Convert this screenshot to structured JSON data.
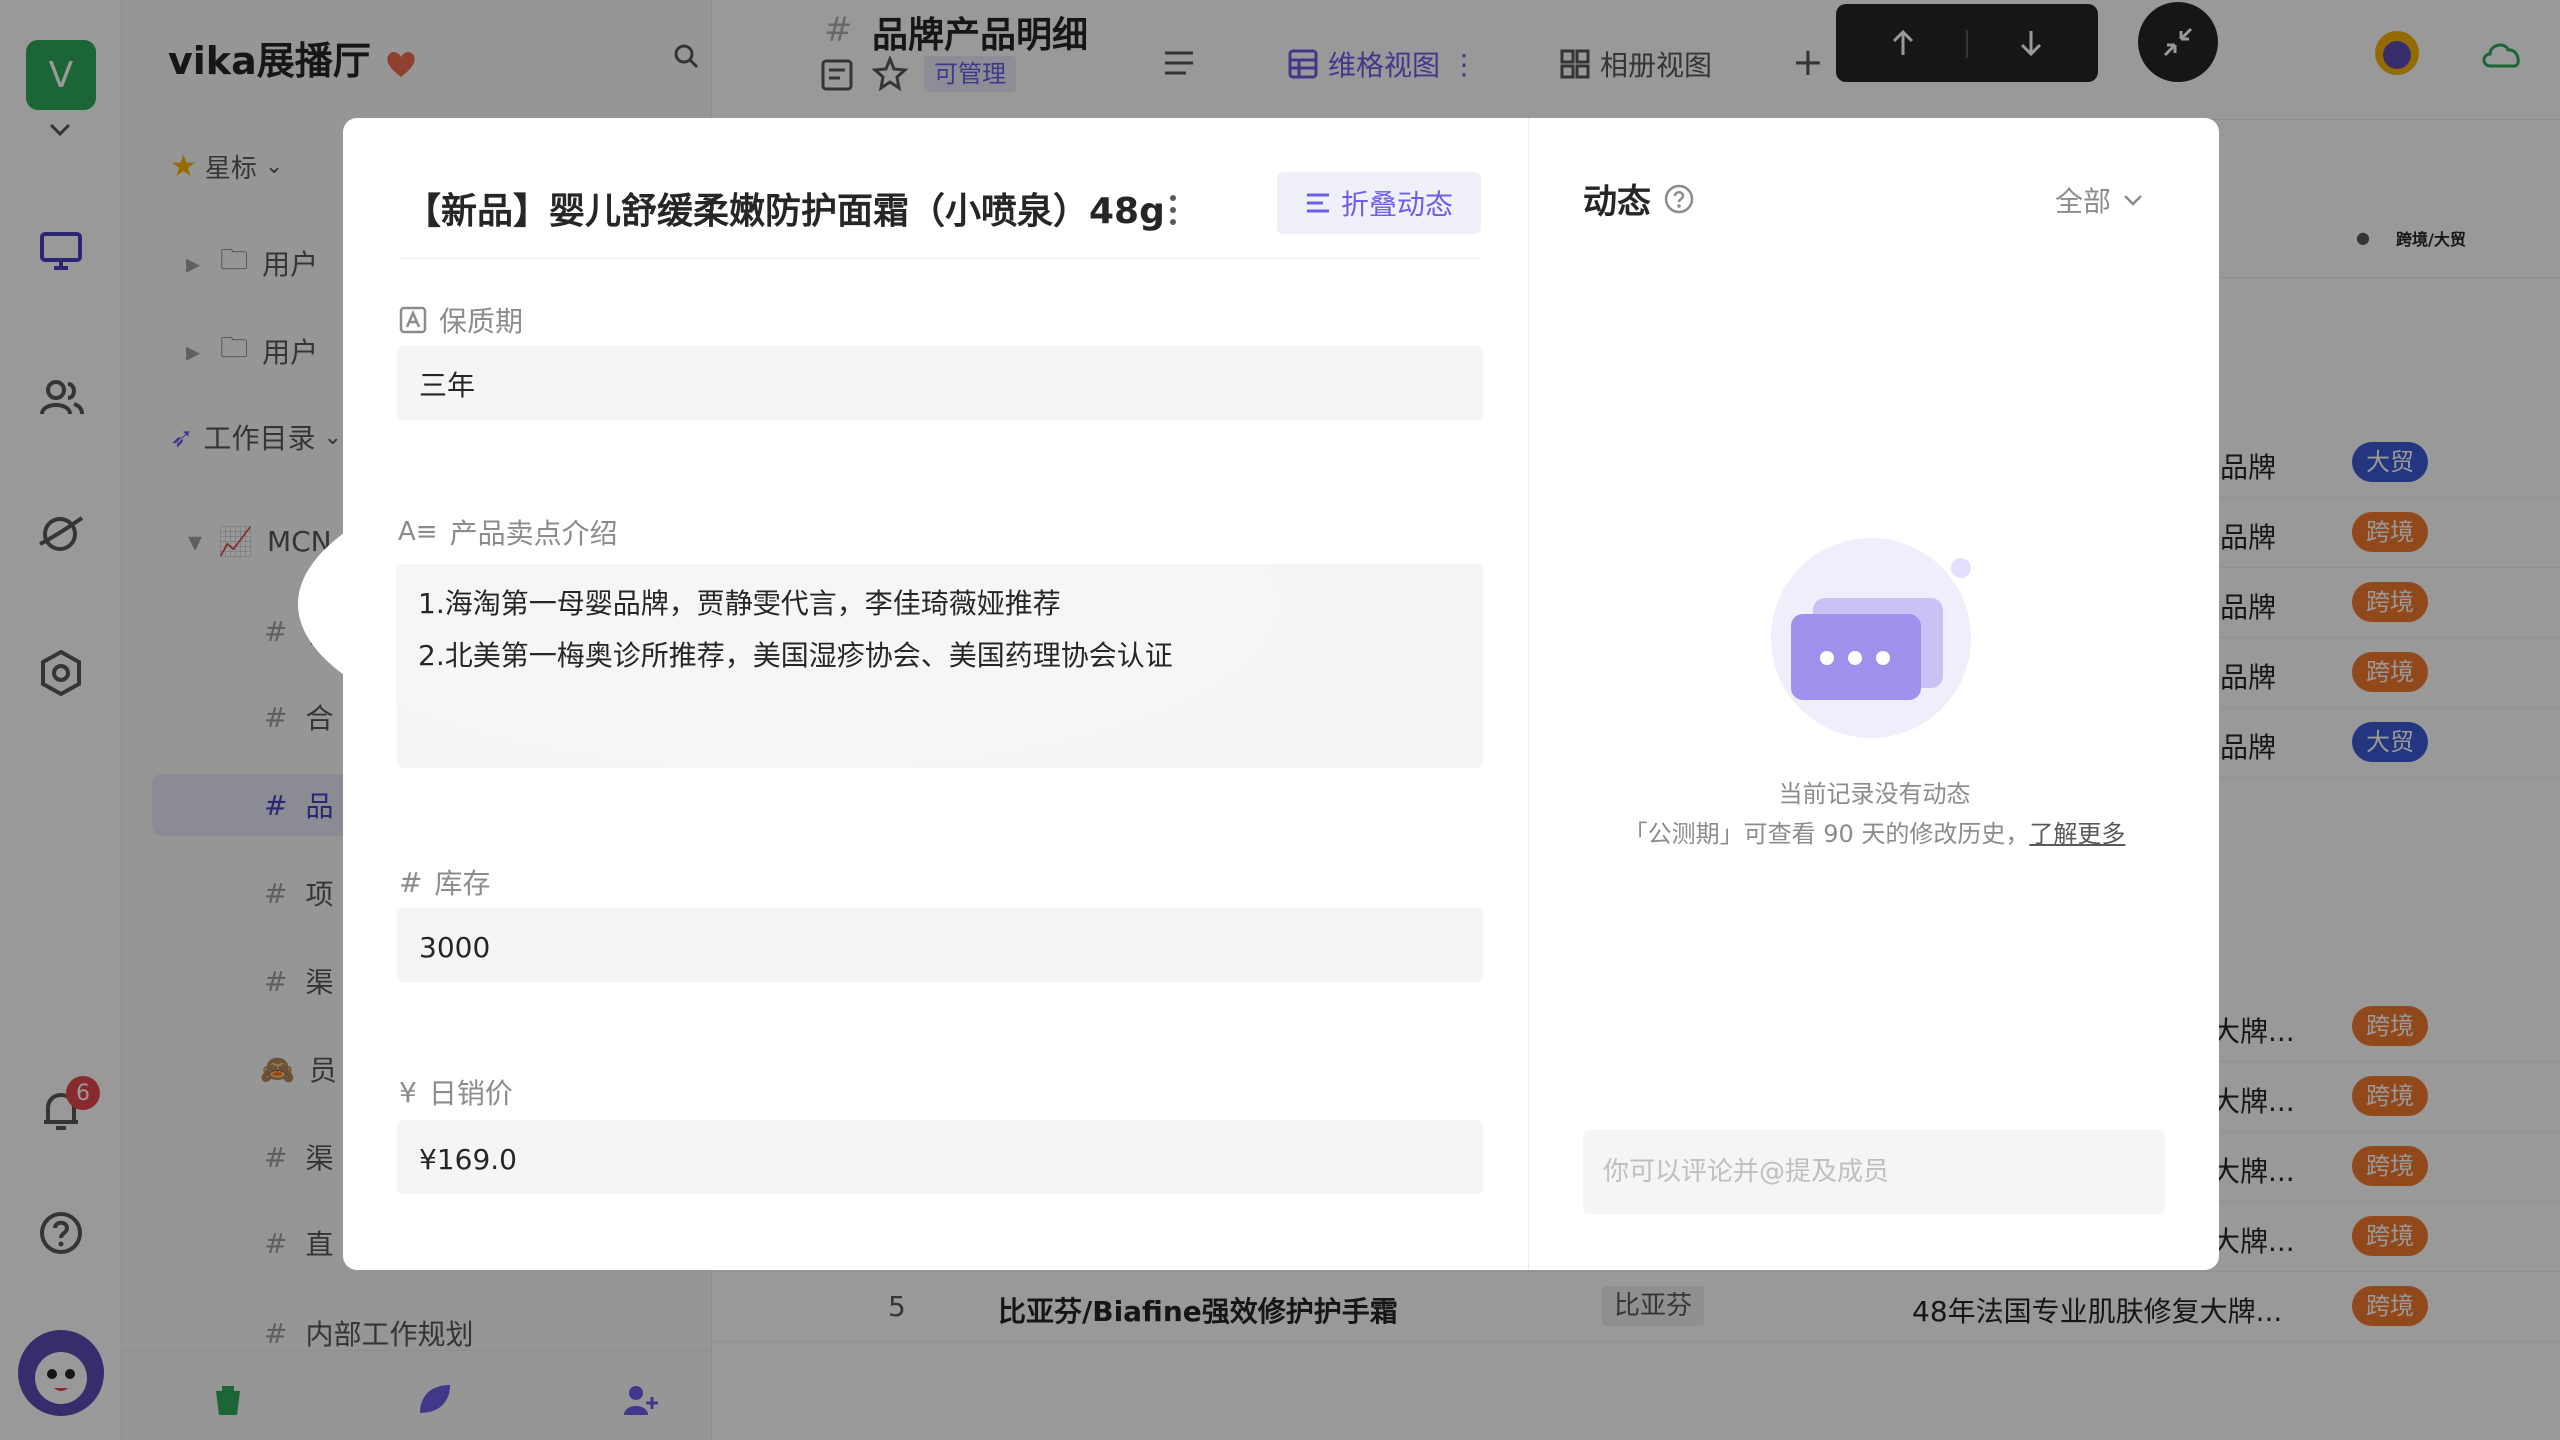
{
  "rail": {
    "workspace_initial": "V",
    "notification_count": "6"
  },
  "sidebar": {
    "space_name": "vika展播厅",
    "starred_label": "星标",
    "items": [
      {
        "label": "用户"
      },
      {
        "label": "用户"
      },
      {
        "label": "工作目录"
      },
      {
        "label": "MCN"
      },
      {
        "label": "合"
      },
      {
        "label": "合"
      },
      {
        "label": "品"
      },
      {
        "label": "项"
      },
      {
        "label": "渠"
      },
      {
        "label": "员"
      },
      {
        "label": "渠"
      },
      {
        "label": "直"
      },
      {
        "label": "内部工作规划"
      }
    ]
  },
  "topbar": {
    "sheet_title": "品牌产品明细",
    "permission": "可管理",
    "grid_view": "维格视图",
    "gallery_view": "相册视图"
  },
  "grid": {
    "col_header_right": "跨境/大贸",
    "rows": [
      {
        "brand": "品牌",
        "tag": "大贸",
        "color": "blue"
      },
      {
        "brand": "品牌",
        "tag": "跨境",
        "color": "orange"
      },
      {
        "brand": "品牌",
        "tag": "跨境",
        "color": "orange"
      },
      {
        "brand": "品牌",
        "tag": "跨境",
        "color": "orange"
      },
      {
        "brand": "品牌",
        "tag": "大贸",
        "color": "blue"
      },
      {
        "brand": "大牌...",
        "tag": "跨境",
        "color": "orange"
      },
      {
        "brand": "大牌...",
        "tag": "跨境",
        "color": "orange"
      },
      {
        "brand": "大牌...",
        "tag": "跨境",
        "color": "orange"
      },
      {
        "brand": "大牌...",
        "tag": "跨境",
        "color": "orange"
      }
    ],
    "last_row": {
      "index": "5",
      "name": "比亚芬/Biafine强效修护护手霜",
      "brand_tag": "比亚芬",
      "desc": "48年法国专业肌肤修复大牌...",
      "tag": "跨境"
    }
  },
  "record": {
    "title": "【新品】婴儿舒缓柔嫩防护面霜（小喷泉）48g",
    "fold_label": "折叠动态",
    "fields": {
      "shelf_life": {
        "label": "保质期",
        "value": "三年"
      },
      "selling_points": {
        "label": "产品卖点介绍",
        "lines": [
          "1.海淘第一母婴品牌，贾静雯代言，李佳琦薇娅推荐",
          "2.北美第一梅奥诊所推荐，美国湿疹协会、美国药理协会认证"
        ]
      },
      "stock": {
        "label": "库存",
        "value": "3000"
      },
      "price": {
        "label": "日销价",
        "value": "¥169.0"
      }
    }
  },
  "activity": {
    "title": "动态",
    "filter": "全部",
    "empty_line1": "当前记录没有动态",
    "empty_line2": "「公测期」可查看 90 天的修改历史，",
    "learn_more": "了解更多",
    "comment_placeholder": "你可以评论并@提及成员"
  },
  "colors": {
    "accent": "#6e5ee8",
    "blue_tag": "#3f5bd6",
    "orange_tag": "#f2782d",
    "workspace": "#2fa85a"
  }
}
